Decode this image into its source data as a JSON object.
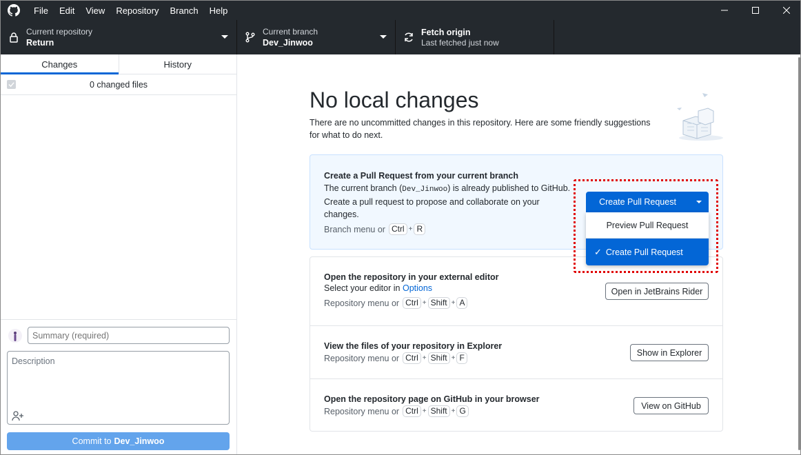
{
  "menubar": {
    "items": [
      "File",
      "Edit",
      "View",
      "Repository",
      "Branch",
      "Help"
    ]
  },
  "toolbar": {
    "repo": {
      "label": "Current repository",
      "value": "Return"
    },
    "branch": {
      "label": "Current branch",
      "value": "Dev_Jinwoo"
    },
    "fetch": {
      "title": "Fetch origin",
      "subtitle": "Last fetched just now"
    }
  },
  "sidebar": {
    "tabs": [
      {
        "label": "Changes",
        "active": true
      },
      {
        "label": "History",
        "active": false
      }
    ],
    "changed_files": "0 changed files",
    "summary_placeholder": "Summary (required)",
    "description_placeholder": "Description",
    "commit_prefix": "Commit to",
    "commit_branch": "Dev_Jinwoo"
  },
  "main": {
    "title": "No local changes",
    "subtitle": "There are no uncommitted changes in this repository. Here are some friendly suggestions for what to do next.",
    "pr_card": {
      "title": "Create a Pull Request from your current branch",
      "desc_before": "The current branch (",
      "branch": "Dev_Jinwoo",
      "desc_after": ") is already published to GitHub. Create a pull request to propose and collaborate on your changes.",
      "shortcut_label": "Branch menu or",
      "keys": [
        "Ctrl",
        "R"
      ],
      "button": "Create Pull Request",
      "menu": {
        "preview": "Preview Pull Request",
        "create": "Create Pull Request"
      }
    },
    "editor_card": {
      "title": "Open the repository in your external editor",
      "desc": "Select your editor in",
      "link": "Options",
      "shortcut_label": "Repository menu or",
      "keys": [
        "Ctrl",
        "Shift",
        "A"
      ],
      "button": "Open in JetBrains Rider"
    },
    "explorer_card": {
      "title": "View the files of your repository in Explorer",
      "shortcut_label": "Repository menu or",
      "keys": [
        "Ctrl",
        "Shift",
        "F"
      ],
      "button": "Show in Explorer"
    },
    "github_card": {
      "title": "Open the repository page on GitHub in your browser",
      "shortcut_label": "Repository menu or",
      "keys": [
        "Ctrl",
        "Shift",
        "G"
      ],
      "button": "View on GitHub"
    }
  },
  "colors": {
    "accent": "#0366d6",
    "toolbar_bg": "#24292e",
    "highlight": "#e00000",
    "commit_button": "#63a4ec"
  }
}
